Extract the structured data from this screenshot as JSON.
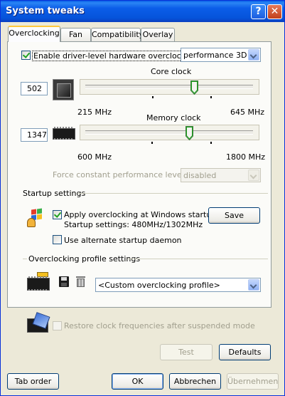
{
  "window": {
    "title": "System tweaks",
    "help_glyph": "?",
    "close_glyph": "✕"
  },
  "tabs": [
    "Overclocking",
    "Fan",
    "Compatibility",
    "Overlay"
  ],
  "overclocking": {
    "enable_label": "Enable driver-level hardware overclocking",
    "enable_checked": true,
    "mode_value": "performance 3D",
    "core": {
      "title": "Core clock",
      "value": "502",
      "min": "215 MHz",
      "max": "645 MHz",
      "position": 0.65
    },
    "memory": {
      "title": "Memory clock",
      "value": "1347",
      "min": "600 MHz",
      "max": "1800 MHz",
      "position": 0.62
    },
    "force_label": "Force constant performance level",
    "force_value": "disabled"
  },
  "startup": {
    "group_title": "Startup settings",
    "apply_label": "Apply overclocking at Windows startup",
    "apply_checked": true,
    "settings_text": "Startup settings: 480MHz/1302MHz",
    "save_label": "Save",
    "alt_daemon_label": "Use alternate startup daemon",
    "alt_daemon_checked": false
  },
  "profiles": {
    "group_title": "Overclocking profile settings",
    "selected": "<Custom overclocking profile>"
  },
  "restore_label": "Restore clock frequencies after suspended mode",
  "buttons": {
    "test": "Test",
    "defaults": "Defaults",
    "tab_order": "Tab order",
    "ok": "OK",
    "cancel": "Abbrechen",
    "apply": "Übernehmen"
  }
}
